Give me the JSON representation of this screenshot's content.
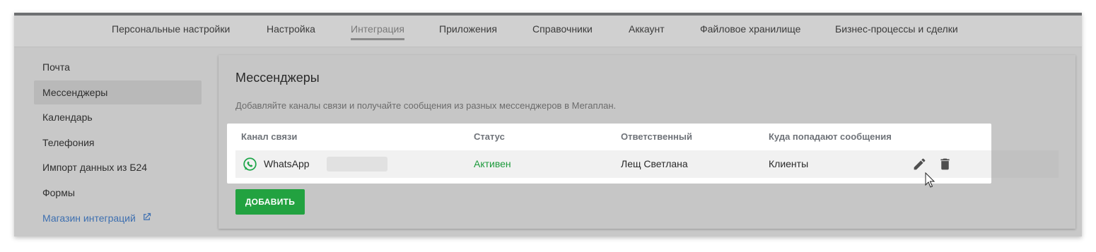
{
  "topnav": {
    "items": [
      {
        "label": "Персональные настройки"
      },
      {
        "label": "Настройка"
      },
      {
        "label": "Интеграция",
        "active": true
      },
      {
        "label": "Приложения"
      },
      {
        "label": "Справочники"
      },
      {
        "label": "Аккаунт"
      },
      {
        "label": "Файловое хранилище"
      },
      {
        "label": "Бизнес-процессы и сделки"
      }
    ]
  },
  "sidebar": {
    "items": [
      {
        "label": "Почта"
      },
      {
        "label": "Мессенджеры",
        "active": true
      },
      {
        "label": "Календарь"
      },
      {
        "label": "Телефония"
      },
      {
        "label": "Импорт данных из Б24"
      },
      {
        "label": "Формы"
      }
    ],
    "store_link": {
      "label": "Магазин интеграций",
      "icon": "external-link-icon"
    }
  },
  "main": {
    "title": "Мессенджеры",
    "description": "Добавляйте каналы связи и получайте сообщения из разных мессенджеров в Мегаплан.",
    "table": {
      "headers": [
        "Канал связи",
        "Статус",
        "Ответственный",
        "Куда попадают сообщения"
      ],
      "rows": [
        {
          "channel": "WhatsApp",
          "channel_icon": "whatsapp-icon",
          "status": "Активен",
          "responsible": "Лещ Светлана",
          "destination": "Клиенты",
          "actions": [
            "edit-icon",
            "trash-icon"
          ]
        }
      ]
    },
    "add_button": "ДОБАВИТЬ"
  },
  "colors": {
    "accent_green": "#22a240",
    "status_active": "#1d9a3c",
    "link_blue": "#3d6fb0",
    "whatsapp_green": "#1fa64a"
  }
}
